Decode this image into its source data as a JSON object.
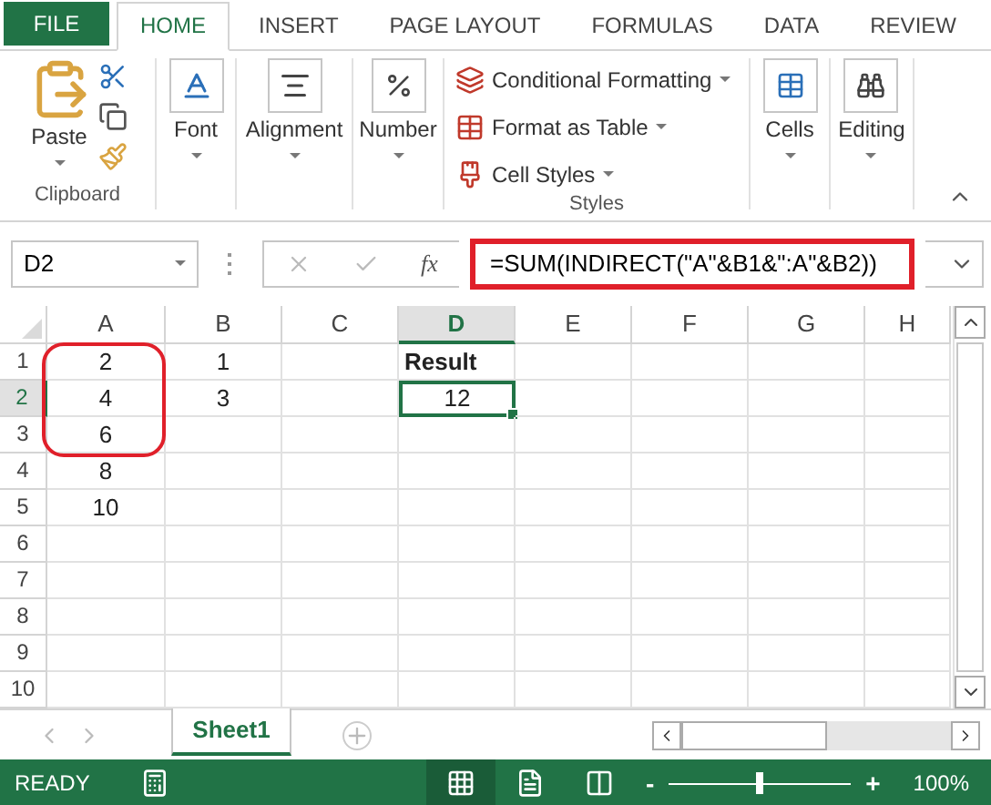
{
  "ribbon_tabs": [
    {
      "label": "FILE",
      "kind": "file",
      "selected": false
    },
    {
      "label": "HOME",
      "kind": "tab",
      "selected": true
    },
    {
      "label": "INSERT",
      "kind": "tab",
      "selected": false
    },
    {
      "label": "PAGE LAYOUT",
      "kind": "tab",
      "selected": false
    },
    {
      "label": "FORMULAS",
      "kind": "tab",
      "selected": false
    },
    {
      "label": "DATA",
      "kind": "tab",
      "selected": false
    },
    {
      "label": "REVIEW",
      "kind": "tab",
      "selected": false
    }
  ],
  "ribbon": {
    "clipboard": {
      "paste": "Paste",
      "label": "Clipboard"
    },
    "font": "Font",
    "alignment": "Alignment",
    "number": "Number",
    "styles": {
      "items": [
        "Conditional Formatting",
        "Format as Table",
        "Cell Styles"
      ],
      "label": "Styles"
    },
    "cells": "Cells",
    "editing": "Editing"
  },
  "formula_bar": {
    "name_box": "D2",
    "formula": "=SUM(INDIRECT(\"A\"&B1&\":A\"&B2))",
    "highlighted": true,
    "function_button": "fx"
  },
  "grid": {
    "range_circled": true,
    "columns": [
      {
        "label": "A",
        "selected": false
      },
      {
        "label": "B",
        "selected": false
      },
      {
        "label": "C",
        "selected": false
      },
      {
        "label": "D",
        "selected": true
      },
      {
        "label": "E",
        "selected": false
      },
      {
        "label": "F",
        "selected": false
      },
      {
        "label": "G",
        "selected": false
      },
      {
        "label": "H",
        "selected": false
      }
    ],
    "rows": [
      {
        "label": "1",
        "selected": false,
        "cells": [
          {
            "text": "2"
          },
          {
            "text": "1"
          },
          null,
          {
            "text": "Result",
            "bold": true
          }
        ]
      },
      {
        "label": "2",
        "selected": true,
        "cells": [
          {
            "text": "4"
          },
          {
            "text": "3"
          },
          null,
          {
            "text": "12",
            "selected": true
          }
        ]
      },
      {
        "label": "3",
        "selected": false,
        "cells": [
          {
            "text": "6"
          }
        ]
      },
      {
        "label": "4",
        "selected": false,
        "cells": [
          {
            "text": "8"
          }
        ]
      },
      {
        "label": "5",
        "selected": false,
        "cells": [
          {
            "text": "10"
          }
        ]
      },
      {
        "label": "6",
        "selected": false,
        "cells": []
      },
      {
        "label": "7",
        "selected": false,
        "cells": []
      },
      {
        "label": "8",
        "selected": false,
        "cells": []
      },
      {
        "label": "9",
        "selected": false,
        "cells": []
      },
      {
        "label": "10",
        "selected": false,
        "cells": []
      }
    ]
  },
  "sheet_tabs": [
    {
      "label": "Sheet1",
      "selected": true
    }
  ],
  "status_bar": {
    "status": "READY",
    "views": [
      {
        "kind": "normal",
        "selected": true
      },
      {
        "kind": "page_layout",
        "selected": false
      },
      {
        "kind": "page_break",
        "selected": false
      }
    ],
    "zoom": {
      "out": "-",
      "in": "+",
      "level": 0.5,
      "reading": "100%"
    }
  }
}
